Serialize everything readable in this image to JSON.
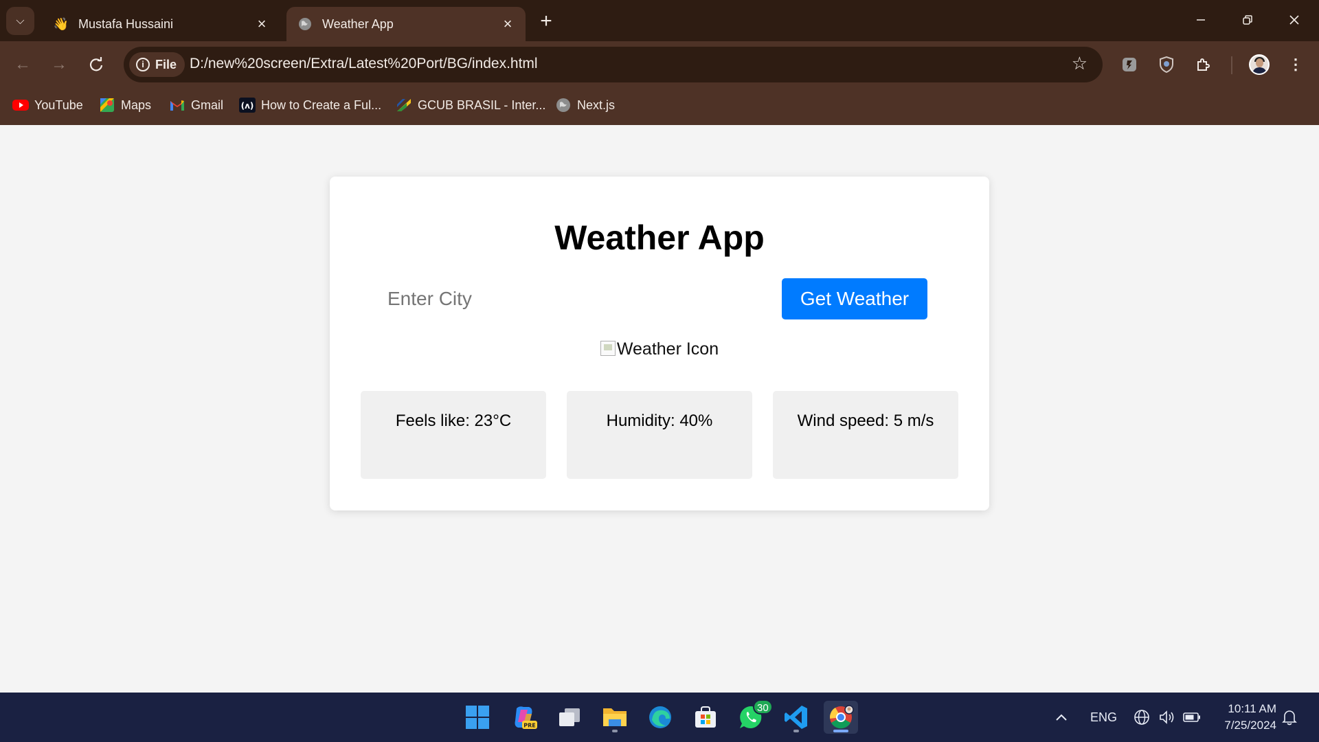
{
  "browser": {
    "tabs": [
      {
        "title": "Mustafa Hussaini",
        "icon": "waving-hand-icon",
        "active": false
      },
      {
        "title": "Weather App",
        "icon": "globe-icon",
        "active": true
      }
    ],
    "omnibox": {
      "scheme_label": "File",
      "url": "D:/new%20screen/Extra/Latest%20Port/BG/index.html"
    },
    "bookmarks": [
      {
        "label": "YouTube",
        "icon": "youtube-icon"
      },
      {
        "label": "Maps",
        "icon": "maps-icon"
      },
      {
        "label": "Gmail",
        "icon": "gmail-icon"
      },
      {
        "label": "How to Create a Ful...",
        "icon": "code-logo-icon"
      },
      {
        "label": "GCUB BRASIL - Inter...",
        "icon": "gcub-icon"
      },
      {
        "label": "Next.js",
        "icon": "globe-icon"
      }
    ]
  },
  "app": {
    "title": "Weather App",
    "city_placeholder": "Enter City",
    "button_label": "Get Weather",
    "icon_alt": "Weather Icon",
    "stats": [
      {
        "label": "Feels like: 23°C"
      },
      {
        "label": "Humidity: 40%"
      },
      {
        "label": "Wind speed: 5 m/s"
      }
    ]
  },
  "taskbar": {
    "apps": [
      "windows-start-icon",
      "copilot-icon",
      "task-view-icon",
      "file-explorer-icon",
      "edge-icon",
      "microsoft-store-icon",
      "whatsapp-icon",
      "vscode-icon",
      "chrome-icon"
    ],
    "whatsapp_badge": "30",
    "language": "ENG",
    "time": "10:11 AM",
    "date": "7/25/2024"
  },
  "colors": {
    "tabbar_bg": "#2e1c12",
    "toolbar_bg": "#4e3226",
    "accent_button": "#007bff",
    "taskbar_bg": "#1a2142"
  }
}
